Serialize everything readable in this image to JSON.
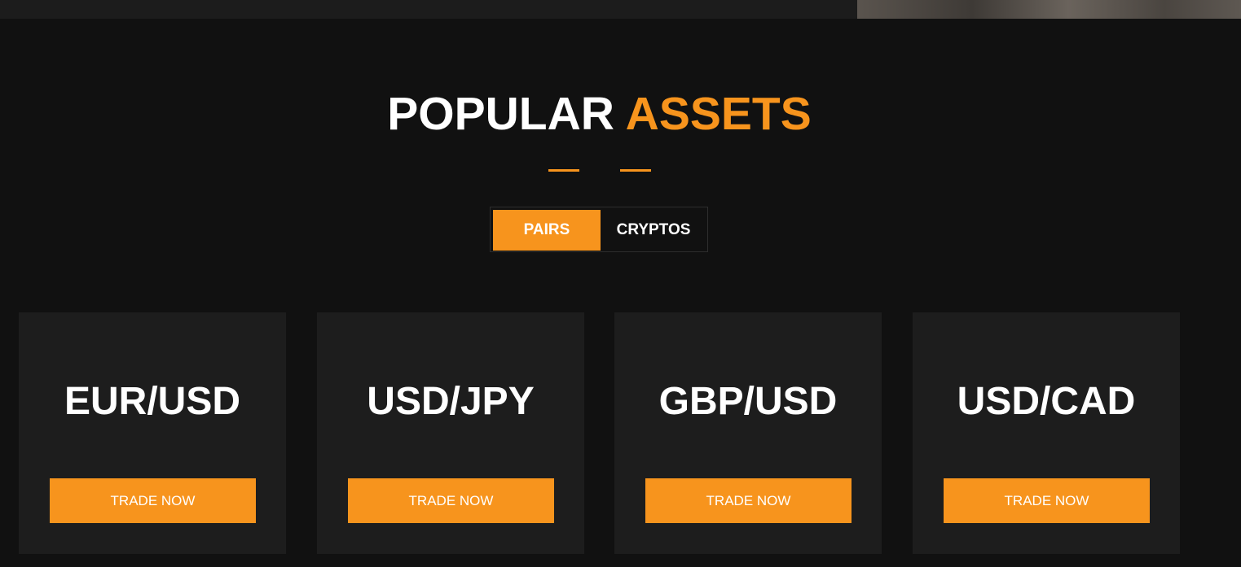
{
  "colors": {
    "accent": "#f7941d",
    "background": "#111111",
    "card_background": "#1d1d1d",
    "text": "#ffffff"
  },
  "section": {
    "title_primary": "POPULAR",
    "title_accent": "ASSETS"
  },
  "tabs": [
    {
      "label": "PAIRS",
      "active": true
    },
    {
      "label": "CRYPTOS",
      "active": false
    }
  ],
  "assets": [
    {
      "pair": "EUR/USD",
      "button_label": "TRADE NOW"
    },
    {
      "pair": "USD/JPY",
      "button_label": "TRADE NOW"
    },
    {
      "pair": "GBP/USD",
      "button_label": "TRADE NOW"
    },
    {
      "pair": "USD/CAD",
      "button_label": "TRADE NOW"
    }
  ]
}
